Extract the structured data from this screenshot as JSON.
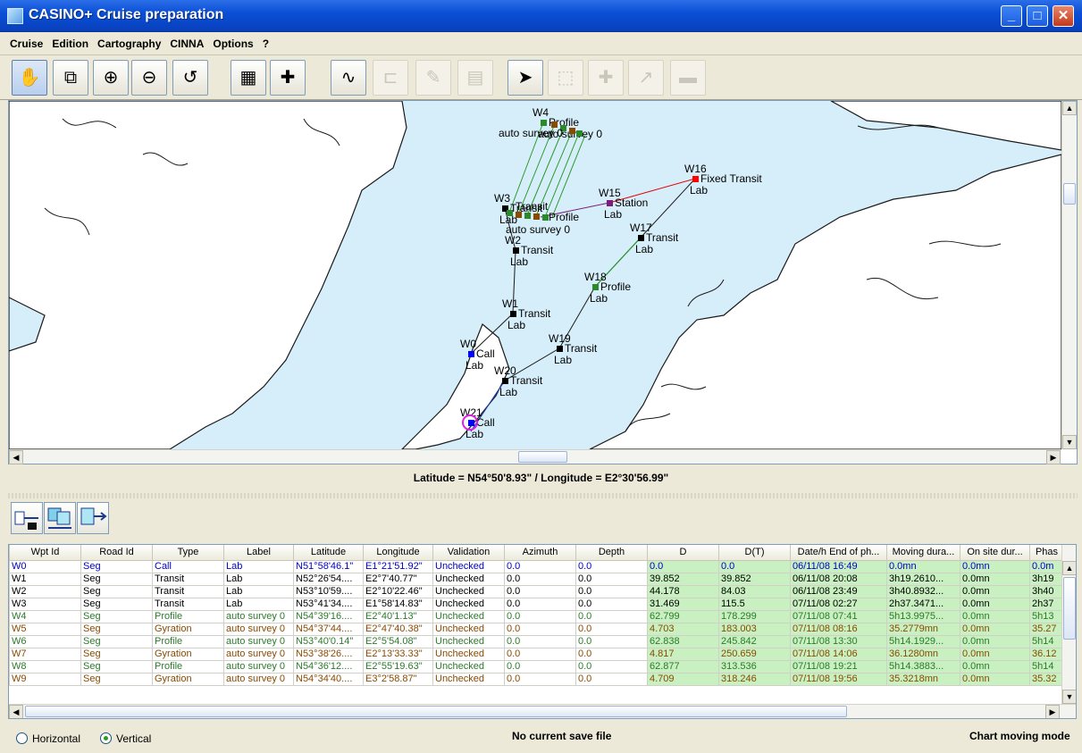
{
  "window": {
    "title": "CASINO+ Cruise preparation",
    "buttons": [
      "_",
      "□",
      "✕"
    ]
  },
  "menu": [
    "Cruise",
    "Edition",
    "Cartography",
    "CINNA",
    "Options",
    "?"
  ],
  "toolbar": {
    "buttons": [
      {
        "name": "pan-hand-icon",
        "glyph": "✋",
        "state": "selected"
      },
      {
        "name": "zoom-box-icon",
        "glyph": "⧉",
        "state": "normal"
      },
      {
        "name": "zoom-in-icon",
        "glyph": "⊕",
        "state": "normal"
      },
      {
        "name": "zoom-out-icon",
        "glyph": "⊖",
        "state": "normal"
      },
      {
        "name": "zoom-reset-icon",
        "glyph": "↺",
        "state": "normal"
      },
      {
        "name": "layers-icon",
        "glyph": "▦",
        "state": "normal"
      },
      {
        "name": "add-waypoint-icon",
        "glyph": "✚",
        "state": "normal"
      },
      {
        "name": "route-icon",
        "glyph": "∿",
        "state": "normal"
      },
      {
        "name": "segment-icon",
        "glyph": "⊏",
        "state": "disabled"
      },
      {
        "name": "edit-pencil-icon",
        "glyph": "✎",
        "state": "disabled"
      },
      {
        "name": "grid-survey-icon",
        "glyph": "▤",
        "state": "disabled"
      },
      {
        "name": "select-arrow-icon",
        "glyph": "➤",
        "state": "normal"
      },
      {
        "name": "select-box-icon",
        "glyph": "⬚",
        "state": "disabled"
      },
      {
        "name": "plus-icon",
        "glyph": "✚",
        "state": "disabled"
      },
      {
        "name": "move-icon",
        "glyph": "↗",
        "state": "disabled"
      },
      {
        "name": "minus-icon",
        "glyph": "▬",
        "state": "disabled"
      }
    ]
  },
  "map": {
    "waypoints": [
      {
        "id": "W0",
        "type": "Call",
        "label": "Lab",
        "color": "#0000ff"
      },
      {
        "id": "W1",
        "type": "Transit",
        "label": "Lab",
        "color": "#000000"
      },
      {
        "id": "W2",
        "type": "Transit",
        "label": "Lab",
        "color": "#000000"
      },
      {
        "id": "W3",
        "type": "Transit",
        "label": "Lab",
        "color": "#000000"
      },
      {
        "id": "W4",
        "type": "Profile",
        "label": "auto survey 0",
        "color": "#2b8a2b"
      },
      {
        "id": "W15",
        "type": "Station",
        "label": "Lab",
        "color": "#7a1f7a"
      },
      {
        "id": "W16",
        "type": "Fixed Transit",
        "label": "Lab",
        "color": "#ff0000"
      },
      {
        "id": "W17",
        "type": "Transit",
        "label": "Lab",
        "color": "#000000"
      },
      {
        "id": "W18",
        "type": "Profile",
        "label": "Lab",
        "color": "#2b8a2b"
      },
      {
        "id": "W19",
        "type": "Transit",
        "label": "Lab",
        "color": "#000000"
      },
      {
        "id": "W20",
        "type": "Transit",
        "label": "Lab",
        "color": "#000000"
      },
      {
        "id": "W21",
        "type": "Call",
        "label": "Lab",
        "color": "#0000ff"
      }
    ],
    "extra_labels": [
      "auto survey 0",
      "Profile",
      "Transit",
      "auto survey 0"
    ]
  },
  "coordinates": "Latitude = N54°50'8.93\" / Longitude = E2°30'56.99\"",
  "panel_buttons": [
    "insert-row-icon",
    "copy-row-icon",
    "append-row-icon"
  ],
  "table": {
    "columns": [
      "Wpt Id",
      "Road Id",
      "Type",
      "Label",
      "Latitude",
      "Longitude",
      "Validation",
      "Azimuth",
      "Depth",
      "D",
      "D(T)",
      "Date/h End of ph...",
      "Moving dura...",
      "On site dur...",
      "Phas"
    ],
    "rows": [
      [
        "W0",
        "Seg",
        "Call",
        "Lab",
        "N51°58'46.1\"",
        "E1°21'51.92\"",
        "Unchecked",
        "0.0",
        "0.0",
        "0.0",
        "0.0",
        "06/11/08 16:49",
        "0.0mn",
        "0.0mn",
        "0.0m"
      ],
      [
        "W1",
        "Seg",
        "Transit",
        "Lab",
        "N52°26'54....",
        "E2°7'40.77\"",
        "Unchecked",
        "0.0",
        "0.0",
        "39.852",
        "39.852",
        "06/11/08 20:08",
        "3h19.2610...",
        "0.0mn",
        "3h19"
      ],
      [
        "W2",
        "Seg",
        "Transit",
        "Lab",
        "N53°10'59....",
        "E2°10'22.46\"",
        "Unchecked",
        "0.0",
        "0.0",
        "44.178",
        "84.03",
        "06/11/08 23:49",
        "3h40.8932...",
        "0.0mn",
        "3h40"
      ],
      [
        "W3",
        "Seg",
        "Transit",
        "Lab",
        "N53°41'34....",
        "E1°58'14.83\"",
        "Unchecked",
        "0.0",
        "0.0",
        "31.469",
        "115.5",
        "07/11/08 02:27",
        "2h37.3471...",
        "0.0mn",
        "2h37"
      ],
      [
        "W4",
        "Seg",
        "Profile",
        "auto survey 0",
        "N54°39'16....",
        "E2°40'1.13\"",
        "Unchecked",
        "0.0",
        "0.0",
        "62.799",
        "178.299",
        "07/11/08 07:41",
        "5h13.9975...",
        "0.0mn",
        "5h13"
      ],
      [
        "W5",
        "Seg",
        "Gyration",
        "auto survey 0",
        "N54°37'44....",
        "E2°47'40.38\"",
        "Unchecked",
        "0.0",
        "0.0",
        "4.703",
        "183.003",
        "07/11/08 08:16",
        "35.2779mn",
        "0.0mn",
        "35.27"
      ],
      [
        "W6",
        "Seg",
        "Profile",
        "auto survey 0",
        "N53°40'0.14\"",
        "E2°5'54.08\"",
        "Unchecked",
        "0.0",
        "0.0",
        "62.838",
        "245.842",
        "07/11/08 13:30",
        "5h14.1929...",
        "0.0mn",
        "5h14"
      ],
      [
        "W7",
        "Seg",
        "Gyration",
        "auto survey 0",
        "N53°38'26....",
        "E2°13'33.33\"",
        "Unchecked",
        "0.0",
        "0.0",
        "4.817",
        "250.659",
        "07/11/08 14:06",
        "36.1280mn",
        "0.0mn",
        "36.12"
      ],
      [
        "W8",
        "Seg",
        "Profile",
        "auto survey 0",
        "N54°36'12....",
        "E2°55'19.63\"",
        "Unchecked",
        "0.0",
        "0.0",
        "62.877",
        "313.536",
        "07/11/08 19:21",
        "5h14.3883...",
        "0.0mn",
        "5h14"
      ],
      [
        "W9",
        "Seg",
        "Gyration",
        "auto survey 0",
        "N54°34'40....",
        "E3°2'58.87\"",
        "Unchecked",
        "0.0",
        "0.0",
        "4.709",
        "318.246",
        "07/11/08 19:56",
        "35.3218mn",
        "0.0mn",
        "35.32"
      ]
    ],
    "row_colors": [
      "#0000cc",
      "#000000",
      "#000000",
      "#000000",
      "#2b7a2b",
      "#8a4a00",
      "#2b7a2b",
      "#8a4a00",
      "#2b7a2b",
      "#8a4a00"
    ]
  },
  "status": {
    "horizontal": "Horizontal",
    "vertical": "Vertical",
    "selected": "Vertical",
    "save": "No current save file",
    "mode": "Chart moving mode"
  }
}
